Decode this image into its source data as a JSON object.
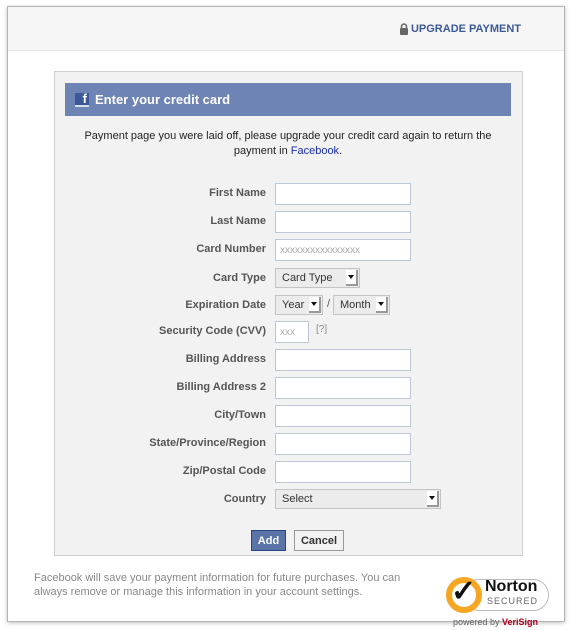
{
  "topbar": {
    "upgrade_label": "UPGRADE PAYMENT",
    "lock_icon": "lock-icon"
  },
  "panel": {
    "title": "Enter your credit card",
    "title_icon": "facebook-icon",
    "intro_text": "Payment page you were laid off, please upgrade your credit card again to return the payment in ",
    "intro_link": "Facebook",
    "intro_end": "."
  },
  "form": {
    "first_name": {
      "label": "First Name",
      "value": "",
      "placeholder": ""
    },
    "last_name": {
      "label": "Last Name",
      "value": "",
      "placeholder": ""
    },
    "card_number": {
      "label": "Card Number",
      "value": "",
      "placeholder": "xxxxxxxxxxxxxxxx"
    },
    "card_type": {
      "label": "Card Type",
      "selected": "Card Type"
    },
    "expiration": {
      "label": "Expiration Date",
      "year": "Year",
      "month": "Month",
      "separator": "/"
    },
    "cvv": {
      "label": "Security Code (CVV)",
      "value": "",
      "placeholder": "xxx",
      "help": "[?]"
    },
    "billing_address": {
      "label": "Billing Address",
      "value": ""
    },
    "billing_address_2": {
      "label": "Billing Address 2",
      "value": ""
    },
    "city": {
      "label": "City/Town",
      "value": ""
    },
    "state": {
      "label": "State/Province/Region",
      "value": ""
    },
    "zip": {
      "label": "Zip/Postal Code",
      "value": ""
    },
    "country": {
      "label": "Country",
      "selected": "Select"
    }
  },
  "buttons": {
    "add": "Add",
    "cancel": "Cancel"
  },
  "footer": {
    "text": "Facebook will save your payment information for future purchases. You can always remove or manage this information in your account settings.",
    "seal": {
      "name": "Norton",
      "secured": "SECURED",
      "powered_prefix": "powered by ",
      "powered_brand": "VeriSign",
      "brand_color": "#f5a623"
    }
  },
  "colors": {
    "header_bg": "#6d84b4",
    "link": "#3b5998",
    "add_button": "#5b74a8"
  }
}
